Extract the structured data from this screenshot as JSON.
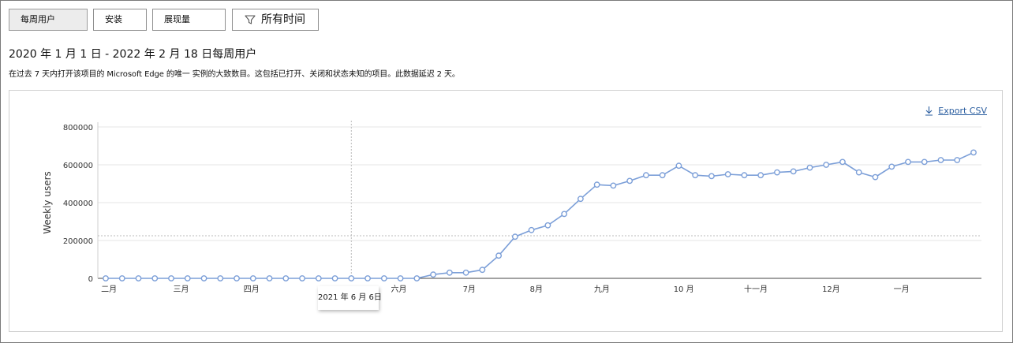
{
  "tabs": {
    "weekly_users": "每周用户",
    "installs": "安装",
    "impressions": "展现量"
  },
  "filter": {
    "label": "所有时间",
    "icon": "filter-icon"
  },
  "title": "2020 年 1 月 1 日 - 2022 年 2 月 18 日每周用户",
  "description": "在过去 7 天内打开该项目的 Microsoft Edge 的唯一 实例的大致数目。这包括已打开、关闭和状态未知的项目。此数据延迟 2 天。",
  "export": {
    "label": "Export CSV",
    "icon": "download-icon"
  },
  "tooltip": {
    "label": "2021 年 6 月 6日"
  },
  "colors": {
    "line": "#7c9fd8",
    "grid": "#e6e6e6",
    "axis": "#444444"
  },
  "chart_data": {
    "type": "line",
    "title": "",
    "xlabel": "",
    "ylabel": "Weekly users",
    "ylim": [
      0,
      800000
    ],
    "yticks": [
      0,
      200000,
      400000,
      600000,
      800000
    ],
    "ytick_labels": [
      "0",
      "200000",
      "400000",
      "600000",
      "800000"
    ],
    "grid": true,
    "legend": "none",
    "month_labels": [
      "二月",
      "三月",
      "四月",
      "六月",
      "7月",
      "8月",
      "九月",
      "10 月",
      "十一月",
      "12月",
      "一月"
    ],
    "month_positions": [
      0.2,
      4.6,
      8.9,
      17.9,
      22.2,
      26.3,
      30.3,
      35.3,
      39.7,
      44.3,
      48.6
    ],
    "hover_index": 15,
    "reference_line": 225000,
    "series": [
      {
        "values": [
          0,
          0,
          0,
          0,
          0,
          0,
          0,
          0,
          0,
          0,
          0,
          0,
          0,
          0,
          0,
          0,
          0,
          0,
          0,
          0,
          20000,
          30000,
          30000,
          45000,
          120000,
          220000,
          255000,
          280000,
          340000,
          420000,
          495000,
          490000,
          515000,
          545000,
          545000,
          595000,
          545000,
          540000,
          550000,
          545000,
          545000,
          560000,
          565000,
          585000,
          600000,
          615000,
          560000,
          535000,
          590000,
          615000,
          615000,
          625000,
          625000,
          665000
        ]
      }
    ]
  }
}
